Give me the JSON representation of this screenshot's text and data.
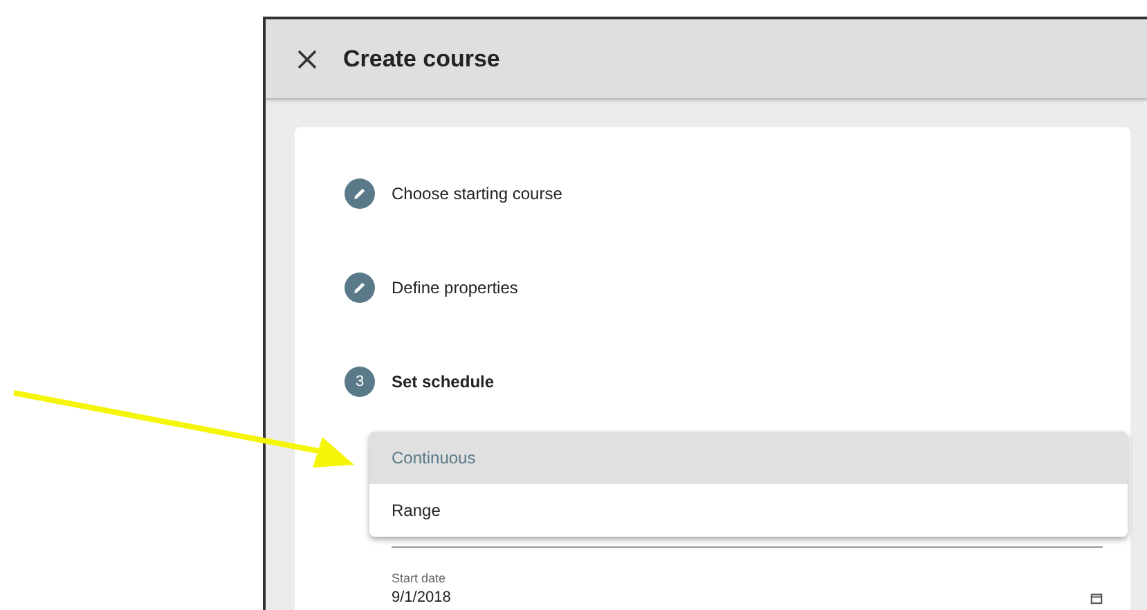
{
  "dialog": {
    "title": "Create course"
  },
  "steps": [
    {
      "kind": "edit",
      "label": "Choose starting course"
    },
    {
      "kind": "edit",
      "label": "Define properties"
    },
    {
      "kind": "number",
      "number": "3",
      "label": "Set schedule"
    }
  ],
  "type_menu": {
    "options": [
      {
        "label": "Continuous",
        "selected": true
      },
      {
        "label": "Range",
        "selected": false
      }
    ]
  },
  "start_date": {
    "label": "Start date",
    "value": "9/1/2018"
  }
}
